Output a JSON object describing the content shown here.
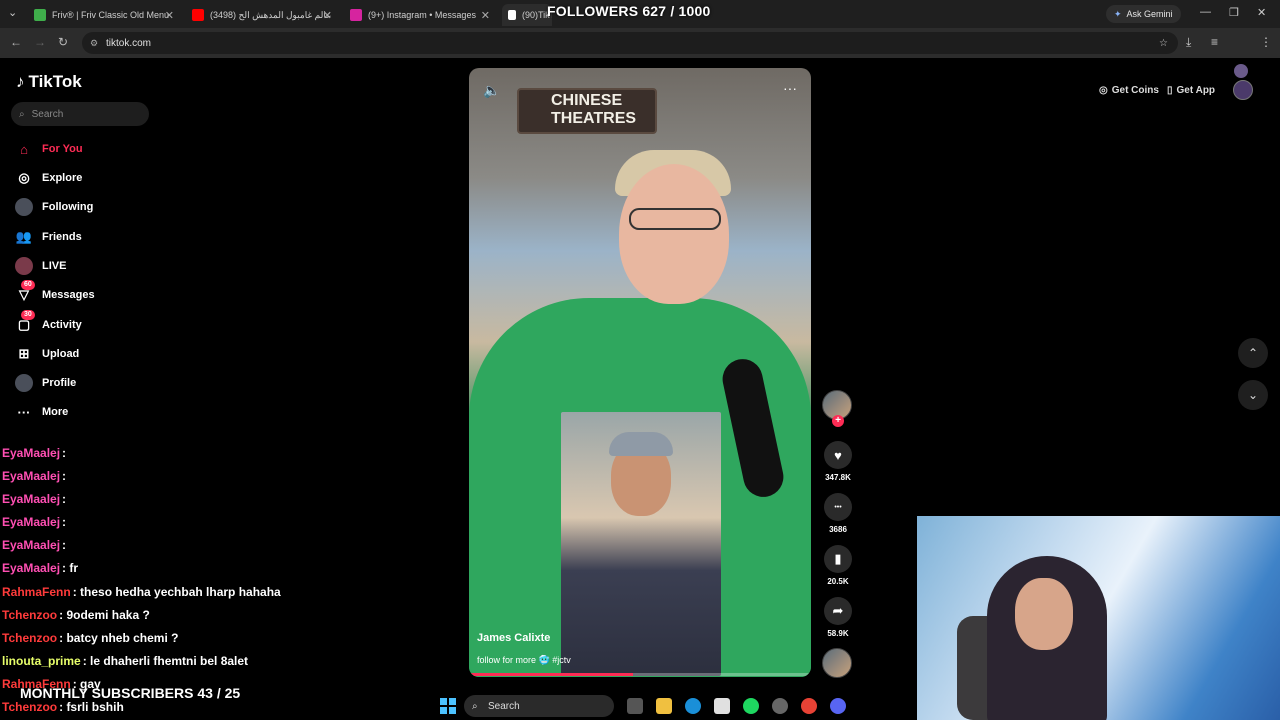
{
  "browser": {
    "tabs": [
      {
        "label": "Friv® | Friv Classic Old Menu",
        "icon_color": "#3fae4b"
      },
      {
        "label": "(3498) عالم غامبول المدهش الح",
        "icon_color": "#ff0000"
      },
      {
        "label": "(9+) Instagram • Messages",
        "icon_color": "#d6249f"
      },
      {
        "label": "(90)TikTok",
        "icon_color": "#ffffff"
      }
    ],
    "ask_gemini": "Ask Gemini",
    "url": "tiktok.com"
  },
  "stream_overlay": {
    "followers": "FOLLOWERS 627 / 1000",
    "monthly_subs": "MONTHLY SUBSCRIBERS 43 / 25"
  },
  "tiktok": {
    "logo": "TikTok",
    "search_placeholder": "Search",
    "nav": [
      {
        "label": "For You",
        "icon": "home-icon",
        "active": true,
        "badge": ""
      },
      {
        "label": "Explore",
        "icon": "compass-icon",
        "active": false,
        "badge": ""
      },
      {
        "label": "Following",
        "icon": "following-avatar-icon",
        "active": false,
        "badge": ""
      },
      {
        "label": "Friends",
        "icon": "friends-icon",
        "active": false,
        "badge": ""
      },
      {
        "label": "LIVE",
        "icon": "live-icon",
        "active": false,
        "badge": ""
      },
      {
        "label": "Messages",
        "icon": "messages-icon",
        "active": false,
        "badge": "60"
      },
      {
        "label": "Activity",
        "icon": "activity-icon",
        "active": false,
        "badge": "30"
      },
      {
        "label": "Upload",
        "icon": "upload-icon",
        "active": false,
        "badge": ""
      },
      {
        "label": "Profile",
        "icon": "profile-icon",
        "active": false,
        "badge": ""
      },
      {
        "label": "More",
        "icon": "more-icon",
        "active": false,
        "badge": ""
      }
    ],
    "video": {
      "sign": "CHINESE THEATRES",
      "author": "James Calixte",
      "description": "follow for more 🥶 #jctv",
      "progress": 0.48
    },
    "actions": [
      {
        "name": "like",
        "icon": "heart-icon",
        "count": "347.8K"
      },
      {
        "name": "comment",
        "icon": "comment-icon",
        "count": "3686"
      },
      {
        "name": "save",
        "icon": "bookmark-icon",
        "count": "20.5K"
      },
      {
        "name": "share",
        "icon": "share-icon",
        "count": "58.9K"
      }
    ],
    "get_coins": "Get Coins",
    "get_app": "Get App"
  },
  "chat": [
    {
      "user": "EyaMaalej",
      "msg": ":",
      "color": "#ff4fb3"
    },
    {
      "user": "EyaMaalej",
      "msg": ":",
      "color": "#ff4fb3"
    },
    {
      "user": "EyaMaalej",
      "msg": ":",
      "color": "#ff4fb3"
    },
    {
      "user": "EyaMaalej",
      "msg": ":",
      "color": "#ff4fb3"
    },
    {
      "user": "EyaMaalej",
      "msg": ":",
      "color": "#ff4fb3"
    },
    {
      "user": "EyaMaalej",
      "msg": ": fr",
      "color": "#ff4fb3"
    },
    {
      "user": "RahmaFenn",
      "msg": ": theso hedha yechbah lharp hahaha",
      "color": "#ff3b3b"
    },
    {
      "user": "Tchenzoo",
      "msg": ": 9odemi haka ?",
      "color": "#ff3b3b"
    },
    {
      "user": "Tchenzoo",
      "msg": ": batcy nheb chemi ?",
      "color": "#ff3b3b"
    },
    {
      "user": "linouta_prime",
      "msg": ": le dhaherli fhemtni bel 8alet",
      "color": "#e8ff6a"
    },
    {
      "user": "RahmaFenn",
      "msg": ": gay",
      "color": "#ff3b3b"
    },
    {
      "user": "Tchenzoo",
      "msg": ": fsrli bshih",
      "color": "#ff3b3b"
    }
  ],
  "taskbar": {
    "search": "Search"
  }
}
